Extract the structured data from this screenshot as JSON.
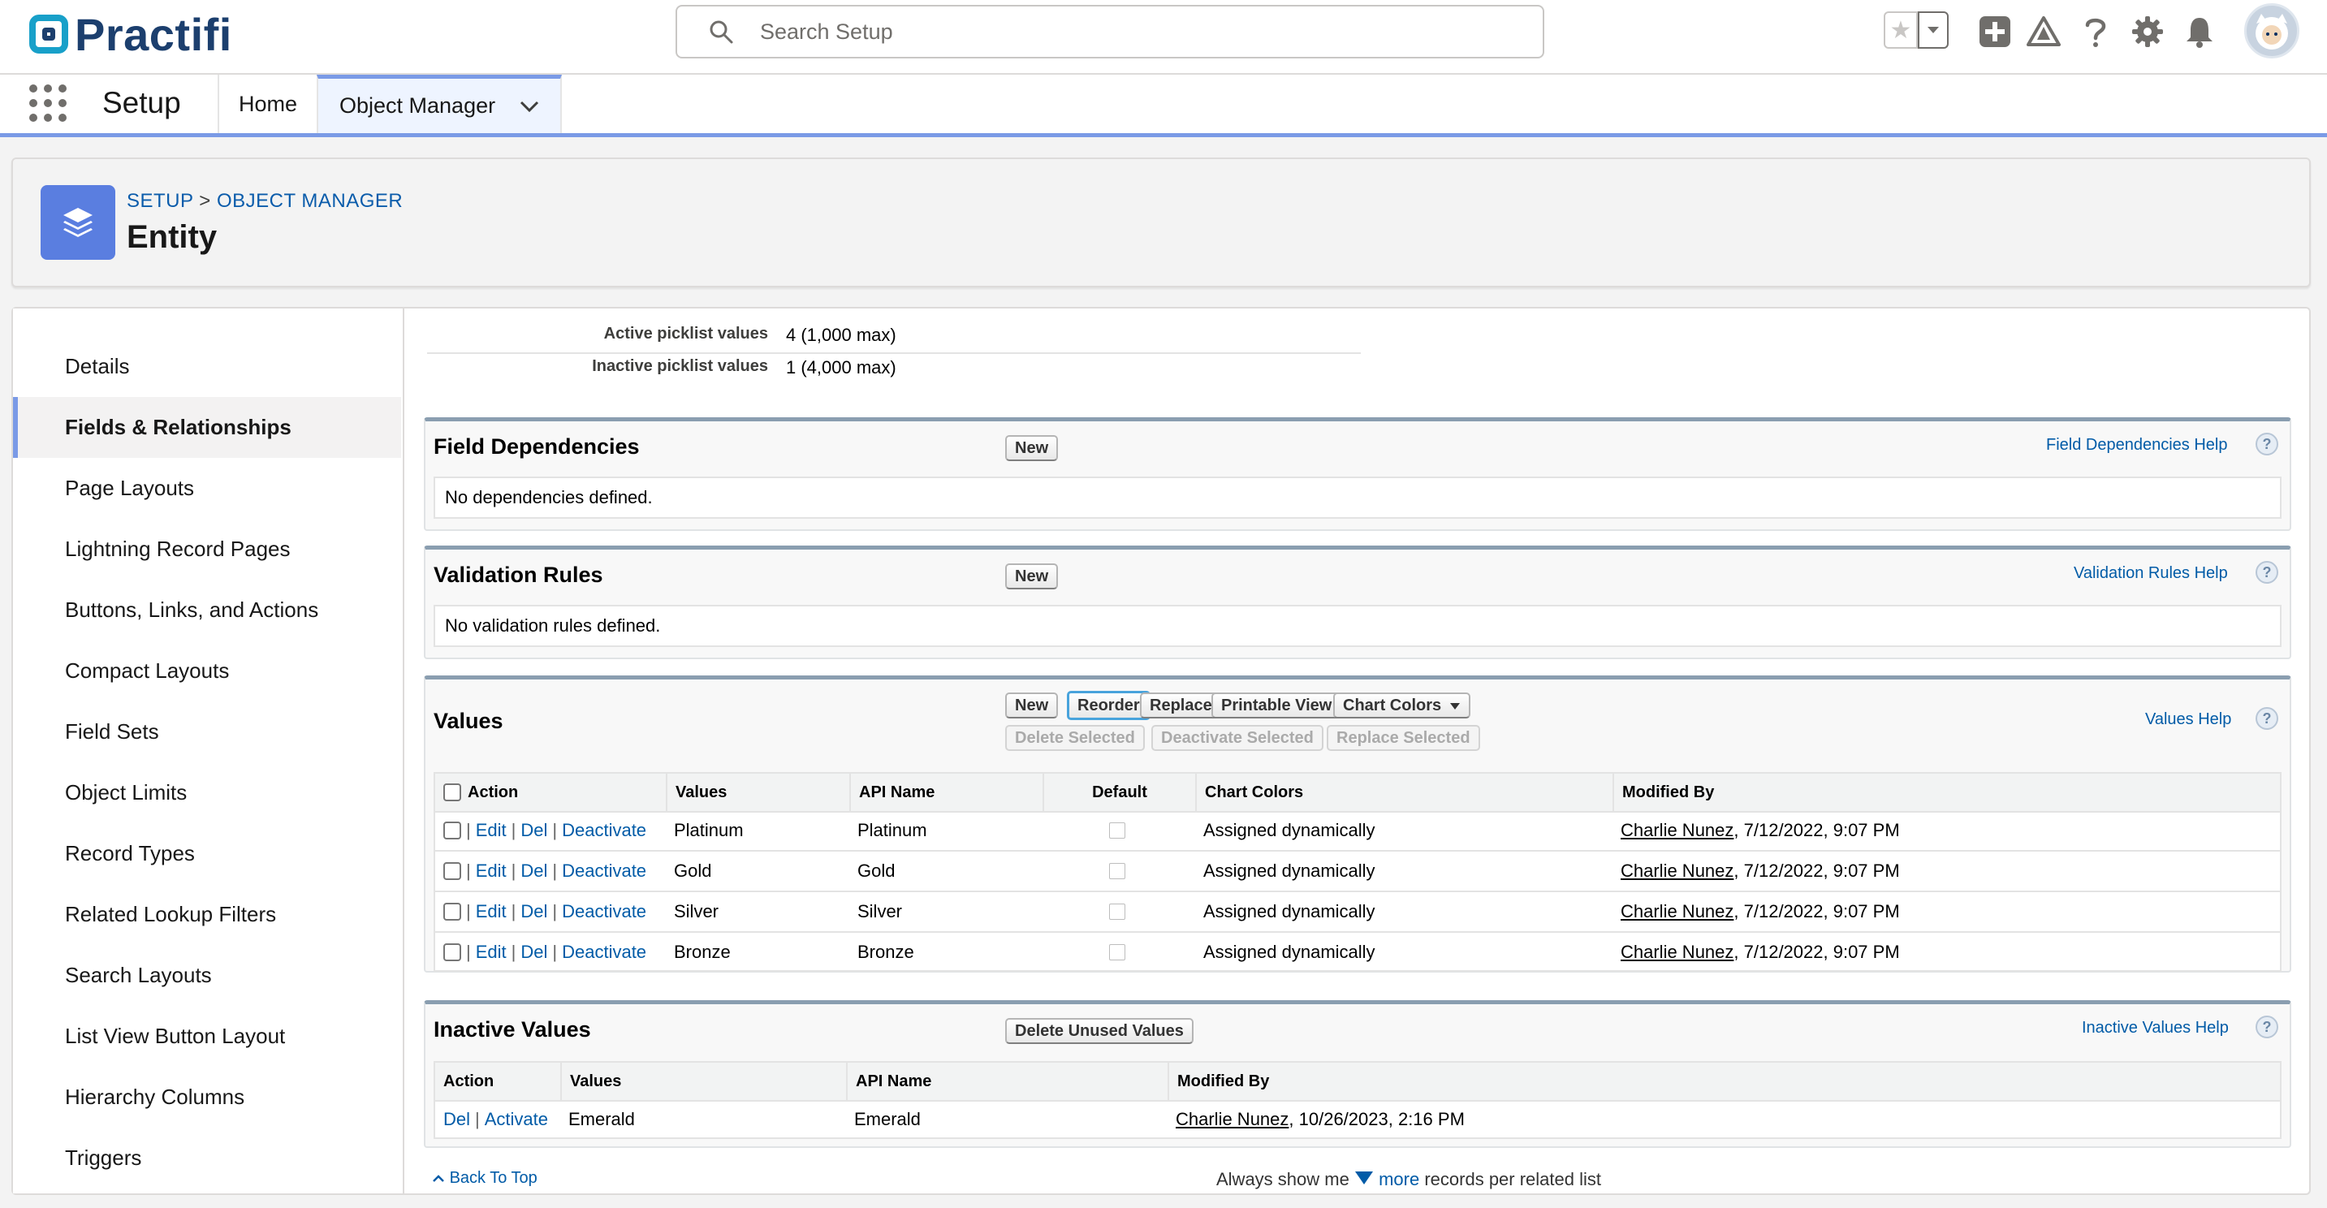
{
  "header": {
    "logo_text": "Practifi",
    "search_placeholder": "Search Setup"
  },
  "nav": {
    "app_name": "Setup",
    "tabs": [
      {
        "label": "Home"
      },
      {
        "label": "Object Manager"
      }
    ]
  },
  "object_header": {
    "breadcrumb_setup": "SETUP",
    "breadcrumb_sep": ">",
    "breadcrumb_object_manager": "OBJECT MANAGER",
    "title": "Entity"
  },
  "sidebar": {
    "items": [
      {
        "label": "Details"
      },
      {
        "label": "Fields & Relationships"
      },
      {
        "label": "Page Layouts"
      },
      {
        "label": "Lightning Record Pages"
      },
      {
        "label": "Buttons, Links, and Actions"
      },
      {
        "label": "Compact Layouts"
      },
      {
        "label": "Field Sets"
      },
      {
        "label": "Object Limits"
      },
      {
        "label": "Record Types"
      },
      {
        "label": "Related Lookup Filters"
      },
      {
        "label": "Search Layouts"
      },
      {
        "label": "List View Button Layout"
      },
      {
        "label": "Hierarchy Columns"
      },
      {
        "label": "Triggers"
      }
    ]
  },
  "summary": {
    "active_label": "Active picklist values",
    "active_value": "4 (1,000 max)",
    "inactive_label": "Inactive picklist values",
    "inactive_value": "1 (4,000 max)"
  },
  "field_dependencies": {
    "title": "Field Dependencies",
    "new_button": "New",
    "help": "Field Dependencies Help",
    "empty": "No dependencies defined."
  },
  "validation_rules": {
    "title": "Validation Rules",
    "new_button": "New",
    "help": "Validation Rules Help",
    "empty": "No validation rules defined."
  },
  "values_section": {
    "title": "Values",
    "help": "Values Help",
    "buttons": {
      "new": "New",
      "reorder": "Reorder",
      "replace": "Replace",
      "printable_view": "Printable View",
      "chart_colors": "Chart Colors",
      "delete_selected": "Delete Selected",
      "deactivate_selected": "Deactivate Selected",
      "replace_selected": "Replace Selected"
    },
    "columns": {
      "action": "Action",
      "values": "Values",
      "api_name": "API Name",
      "default": "Default",
      "chart_colors": "Chart Colors",
      "modified_by": "Modified By"
    },
    "action_links": {
      "edit": "Edit",
      "del": "Del",
      "deactivate": "Deactivate",
      "sep": "|"
    },
    "rows": [
      {
        "value": "Platinum",
        "api_name": "Platinum",
        "chart_color": "Assigned dynamically",
        "modified_user": "Charlie Nunez",
        "modified_date": ", 7/12/2022, 9:07 PM"
      },
      {
        "value": "Gold",
        "api_name": "Gold",
        "chart_color": "Assigned dynamically",
        "modified_user": "Charlie Nunez",
        "modified_date": ", 7/12/2022, 9:07 PM"
      },
      {
        "value": "Silver",
        "api_name": "Silver",
        "chart_color": "Assigned dynamically",
        "modified_user": "Charlie Nunez",
        "modified_date": ", 7/12/2022, 9:07 PM"
      },
      {
        "value": "Bronze",
        "api_name": "Bronze",
        "chart_color": "Assigned dynamically",
        "modified_user": "Charlie Nunez",
        "modified_date": ", 7/12/2022, 9:07 PM"
      }
    ]
  },
  "inactive_values": {
    "title": "Inactive Values",
    "delete_unused_button": "Delete Unused Values",
    "help": "Inactive Values Help",
    "columns": {
      "action": "Action",
      "values": "Values",
      "api_name": "API Name",
      "modified_by": "Modified By"
    },
    "action_links": {
      "del": "Del",
      "activate": "Activate",
      "sep": "|"
    },
    "rows": [
      {
        "value": "Emerald",
        "api_name": "Emerald",
        "modified_user": "Charlie Nunez",
        "modified_date": ", 10/26/2023, 2:16 PM"
      }
    ]
  },
  "footer": {
    "back_to_top": "Back To Top",
    "always_show": "Always show me",
    "more": "more",
    "records_per_list": "records per related list"
  },
  "colors": {
    "brand_navy": "#1c3f6e",
    "brand_teal": "#18a0c9",
    "link_blue": "#015ba7",
    "accent_blue": "#7a9ae6",
    "object_icon": "#5a7ee0"
  }
}
